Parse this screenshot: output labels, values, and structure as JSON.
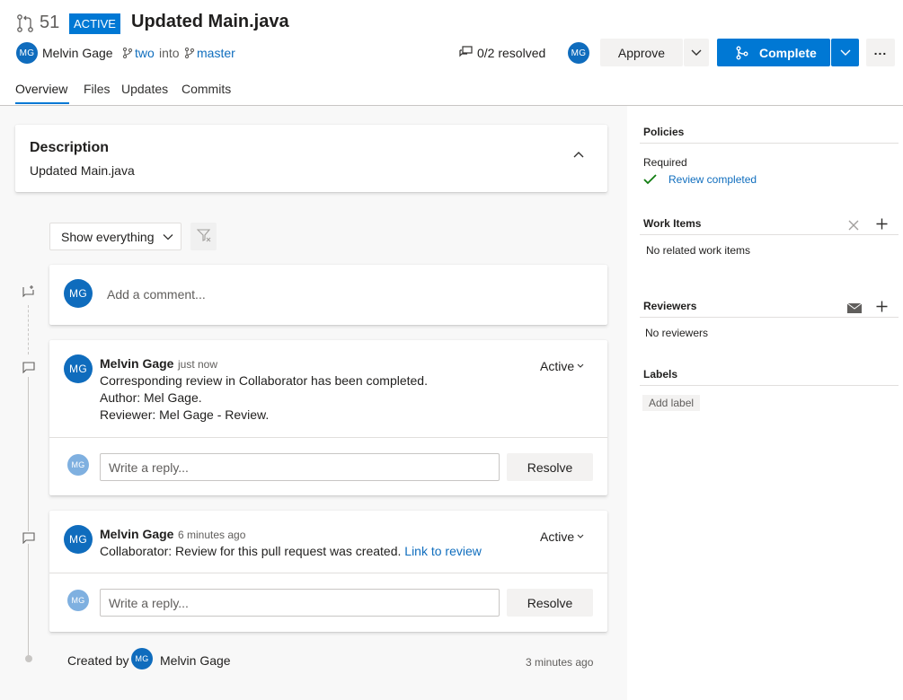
{
  "header": {
    "pr_number": "51",
    "status_badge": "ACTIVE",
    "title": "Updated Main.java",
    "author_initials": "MG",
    "author_name": "Melvin Gage",
    "source_branch": "two",
    "into_text": "into",
    "target_branch": "master",
    "resolved_text": "0/2 resolved",
    "reviewer_initials": "MG",
    "approve_label": "Approve",
    "complete_label": "Complete"
  },
  "tabs": [
    "Overview",
    "Files",
    "Updates",
    "Commits"
  ],
  "description": {
    "heading": "Description",
    "text": "Updated Main.java"
  },
  "filter": {
    "label": "Show everything"
  },
  "comment_box": {
    "avatar": "MG",
    "placeholder": "Add a comment..."
  },
  "threads": [
    {
      "avatar": "MG",
      "author": "Melvin Gage",
      "time": "just now",
      "status": "Active",
      "lines": [
        "Corresponding review in Collaborator has been completed.",
        "Author: Mel Gage.",
        "Reviewer: Mel Gage - Review."
      ],
      "reply_avatar": "MG",
      "reply_placeholder": "Write a reply...",
      "resolve_label": "Resolve"
    },
    {
      "avatar": "MG",
      "author": "Melvin Gage",
      "time": "6 minutes ago",
      "status": "Active",
      "text": "Collaborator: Review for this pull request was created.",
      "link_text": "Link to review",
      "reply_avatar": "MG",
      "reply_placeholder": "Write a reply...",
      "resolve_label": "Resolve"
    }
  ],
  "created": {
    "prefix": "Created by",
    "avatar": "MG",
    "name": "Melvin Gage",
    "time": "3 minutes ago"
  },
  "sidebar": {
    "policies_title": "Policies",
    "required_label": "Required",
    "review_completed": "Review completed",
    "work_items_title": "Work Items",
    "no_work_items": "No related work items",
    "reviewers_title": "Reviewers",
    "no_reviewers": "No reviewers",
    "labels_title": "Labels",
    "add_label": "Add label"
  },
  "colors": {
    "brand_blue": "#0f6cbd",
    "status_active": "#0078d4",
    "check_green": "#107c10"
  }
}
